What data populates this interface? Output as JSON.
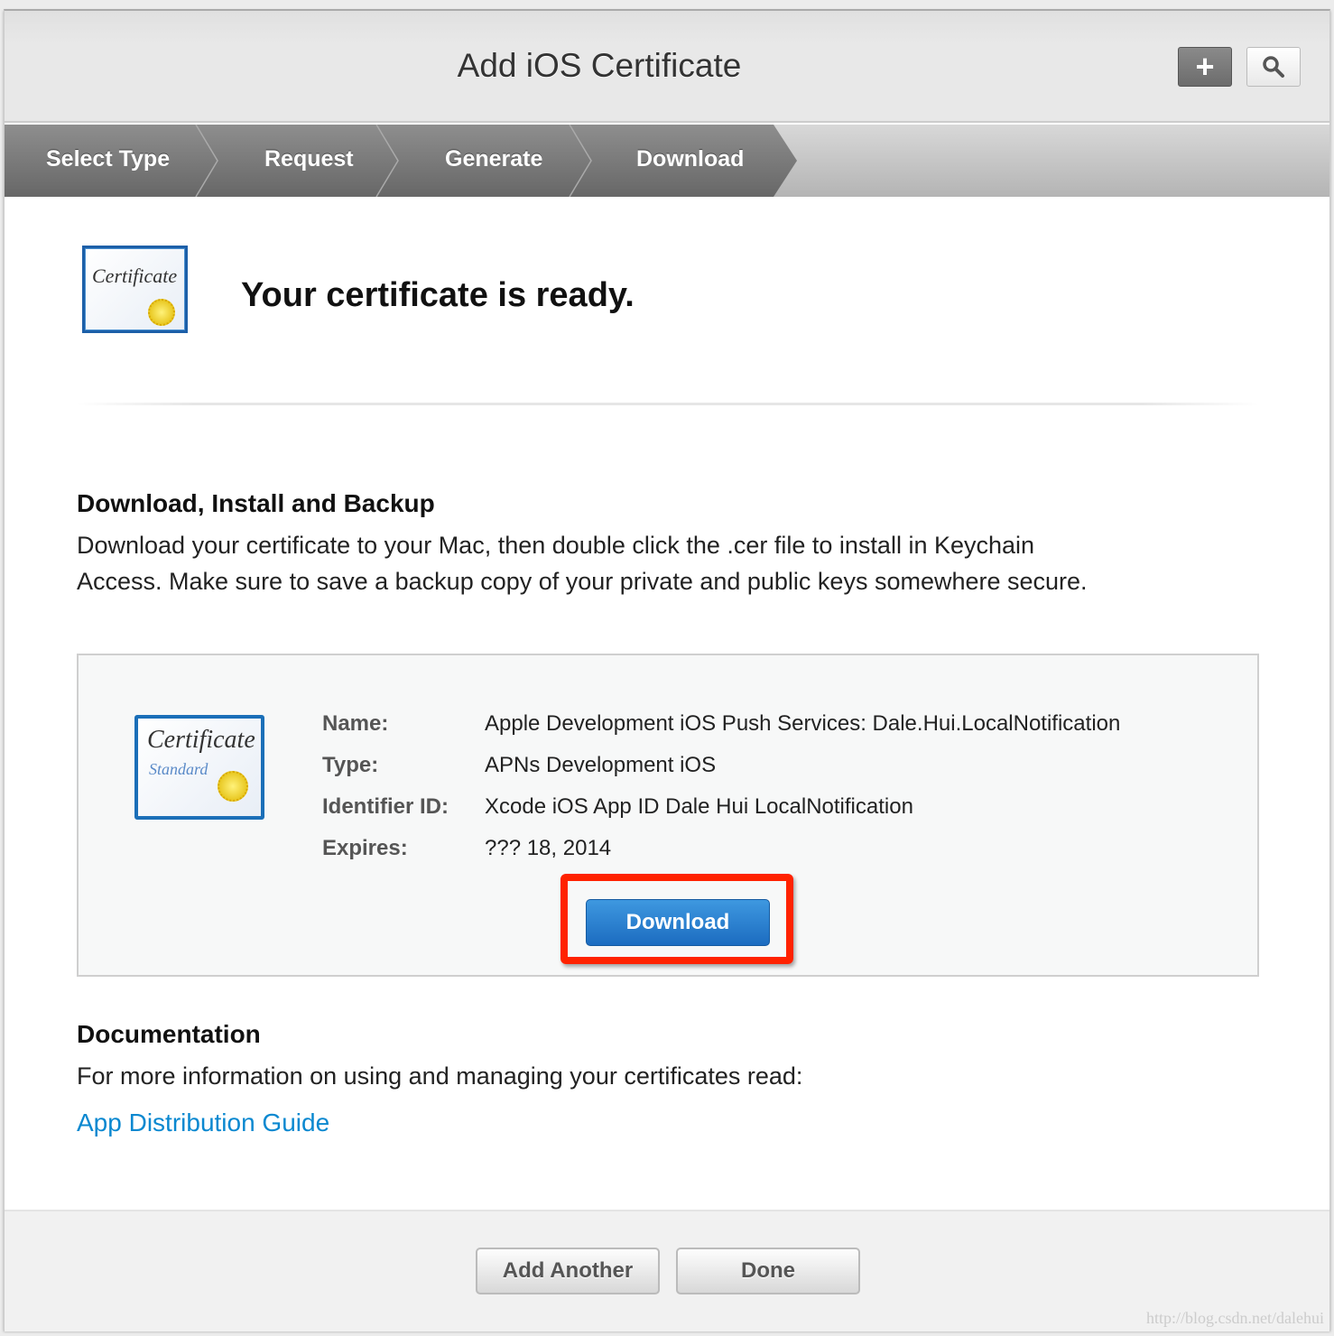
{
  "header": {
    "title": "Add iOS Certificate",
    "add_icon": "plus-icon",
    "search_icon": "search-icon"
  },
  "steps": [
    "Select Type",
    "Request",
    "Generate",
    "Download"
  ],
  "status": {
    "title": "Your certificate is ready.",
    "icon_text": "Certificate"
  },
  "install": {
    "heading": "Download, Install and Backup",
    "line1": "Download your certificate to your Mac, then double click the .cer file to install in Keychain",
    "line2": "Access. Make sure to save a backup copy of your private and public keys somewhere secure."
  },
  "certificate": {
    "fields": [
      {
        "label": "Name:",
        "value": "Apple Development iOS Push Services: Dale.Hui.LocalNotification"
      },
      {
        "label": "Type:",
        "value": "APNs Development iOS"
      },
      {
        "label": "Identifier ID:",
        "value": "Xcode iOS App ID Dale Hui LocalNotification"
      },
      {
        "label": "Expires:",
        "value": "??? 18, 2014"
      }
    ],
    "download_label": "Download",
    "icon_text": "Certificate",
    "icon_subtext": "Standard",
    "highlight_color": "#ff2200"
  },
  "documentation": {
    "heading": "Documentation",
    "text": "For more information on using and managing your certificates read:",
    "link": "App Distribution Guide"
  },
  "footer": {
    "add_another": "Add Another",
    "done": "Done",
    "watermark": "http://blog.csdn.net/dalehui"
  }
}
